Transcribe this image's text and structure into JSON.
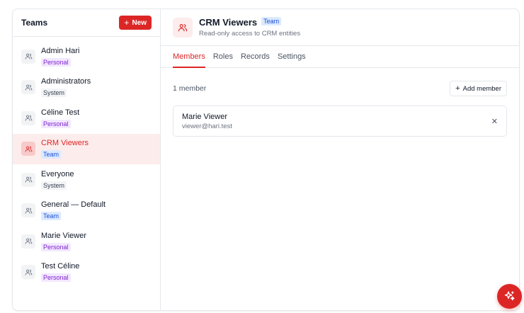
{
  "sidebar": {
    "title": "Teams",
    "new_button": {
      "label": "New",
      "icon": "plus-icon"
    },
    "items": [
      {
        "name": "Admin Hari",
        "badge": "Personal",
        "badge_type": "personal"
      },
      {
        "name": "Administrators",
        "badge": "System",
        "badge_type": "system"
      },
      {
        "name": "Céline Test",
        "badge": "Personal",
        "badge_type": "personal"
      },
      {
        "name": "CRM Viewers",
        "badge": "Team",
        "badge_type": "team",
        "active": true
      },
      {
        "name": "Everyone",
        "badge": "System",
        "badge_type": "system"
      },
      {
        "name": "General — Default",
        "badge": "Team",
        "badge_type": "team"
      },
      {
        "name": "Marie Viewer",
        "badge": "Personal",
        "badge_type": "personal"
      },
      {
        "name": "Test Céline",
        "badge": "Personal",
        "badge_type": "personal"
      }
    ]
  },
  "header": {
    "title": "CRM Viewers",
    "badge": "Team",
    "description": "Read-only access to CRM entities",
    "icon": "users-icon"
  },
  "tabs": [
    {
      "label": "Members",
      "active": true
    },
    {
      "label": "Roles",
      "active": false
    },
    {
      "label": "Records",
      "active": false
    },
    {
      "label": "Settings",
      "active": false
    }
  ],
  "members": {
    "count_label": "1 member",
    "add_button": {
      "label": "Add member",
      "icon": "plus-icon"
    },
    "list": [
      {
        "name": "Marie Viewer",
        "email": "viewer@hari.test",
        "remove_icon": "close-icon"
      }
    ]
  },
  "fab": {
    "icon": "sparkles-icon"
  },
  "colors": {
    "accent": "#dc2626",
    "accent_light": "#fdecec",
    "personal_badge": "#7e22ce",
    "team_badge": "#1d4ed8"
  }
}
